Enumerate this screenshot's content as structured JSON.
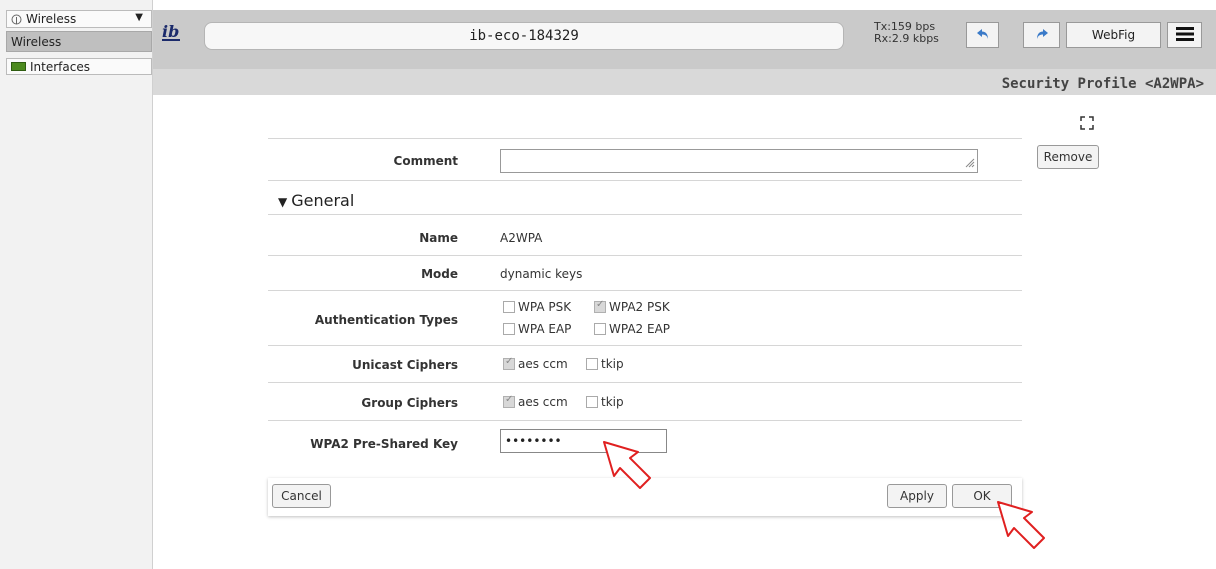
{
  "sidebar": {
    "select_label": "Wireless",
    "items": [
      {
        "label": "Wireless"
      },
      {
        "label": "Interfaces"
      }
    ]
  },
  "header": {
    "hostname": "ib-eco-184329",
    "tx": "Tx:159 bps",
    "rx": "Rx:2.9 kbps",
    "webfig_label": "WebFig",
    "page_title": "Security Profile <A2WPA>"
  },
  "form": {
    "comment_label": "Comment",
    "comment_value": "",
    "section_general": "General",
    "name_label": "Name",
    "name_value": "A2WPA",
    "mode_label": "Mode",
    "mode_value": "dynamic keys",
    "auth_label": "Authentication Types",
    "auth_options": [
      {
        "label": "WPA PSK",
        "checked": false
      },
      {
        "label": "WPA2 PSK",
        "checked": true
      },
      {
        "label": "WPA EAP",
        "checked": false
      },
      {
        "label": "WPA2 EAP",
        "checked": false
      }
    ],
    "unicast_label": "Unicast Ciphers",
    "unicast_options": [
      {
        "label": "aes ccm",
        "checked": true
      },
      {
        "label": "tkip",
        "checked": false
      }
    ],
    "group_label": "Group Ciphers",
    "group_options": [
      {
        "label": "aes ccm",
        "checked": true
      },
      {
        "label": "tkip",
        "checked": false
      }
    ],
    "psk_label": "WPA2 Pre-Shared Key",
    "psk_value": "••••••••"
  },
  "buttons": {
    "remove": "Remove",
    "cancel": "Cancel",
    "apply": "Apply",
    "ok": "OK"
  },
  "colors": {
    "header_bg": "#cacaca",
    "annotation_arrow": "#e02020"
  }
}
